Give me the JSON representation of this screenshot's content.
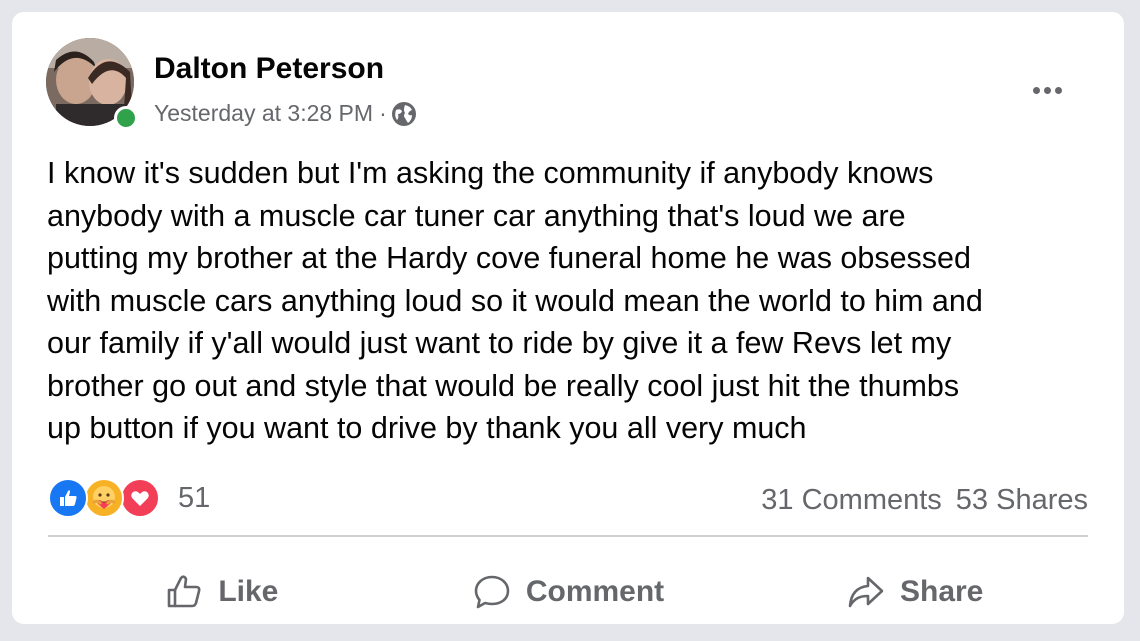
{
  "post": {
    "author": "Dalton Peterson",
    "timestamp": "Yesterday at 3:28 PM",
    "separator": "·",
    "privacy_icon": "globe-icon",
    "more_icon": "more-options-icon",
    "body": "I know it's sudden but I'm asking the community if anybody knows\nanybody with a muscle car tuner car anything that's loud we are\nputting my brother at the Hardy cove funeral home he was obsessed\nwith muscle cars anything loud so it would mean the world to him and\nour family if y'all would just want to ride by give it a few Revs let my\nbrother go out and style that would be really cool just hit the thumbs\nup button if you want to drive by thank you all very much"
  },
  "reactions": {
    "icons": [
      "like-reaction-icon",
      "care-reaction-icon",
      "love-reaction-icon"
    ],
    "count": "51"
  },
  "stats": {
    "comments": "31 Comments",
    "shares": "53 Shares"
  },
  "actions": {
    "like_label": "Like",
    "comment_label": "Comment",
    "share_label": "Share"
  },
  "colors": {
    "like_blue": "#1877f2",
    "love_red": "#f33e58",
    "care_yellow": "#f7b125",
    "online_green": "#31a24c",
    "secondary_text": "#65676b"
  }
}
